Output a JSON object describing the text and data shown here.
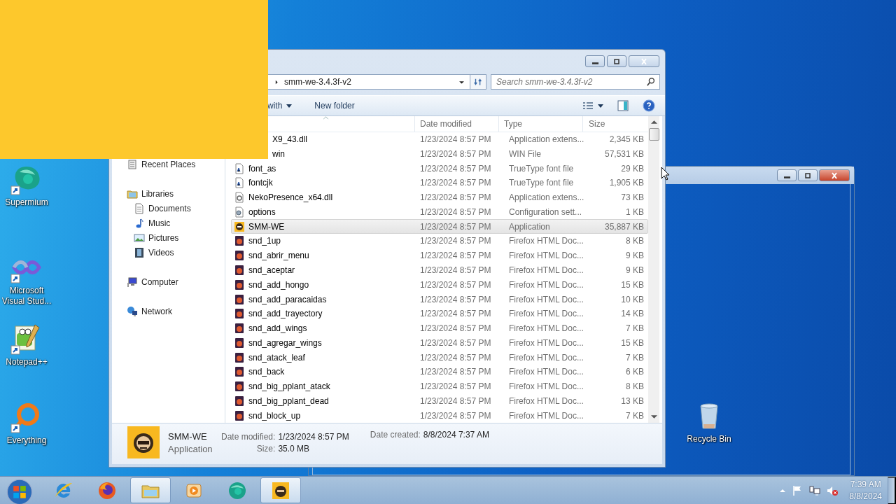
{
  "desktop_icons": [
    {
      "label": "Supermium",
      "kind": "supermium"
    },
    {
      "label": "Microsoft Visual Stud...",
      "kind": "vs"
    },
    {
      "label": "Notepad++",
      "kind": "notepad"
    },
    {
      "label": "Everything",
      "kind": "everything"
    },
    {
      "label": "Recycle Bin",
      "kind": "recycle"
    }
  ],
  "explorer": {
    "address": {
      "crumb": "smm-we-3.4.3f-v2"
    },
    "search": {
      "placeholder": "Search smm-we-3.4.3f-v2"
    },
    "toolbar": [
      {
        "label": "with",
        "kind": "menu"
      },
      {
        "label": "New folder",
        "kind": "plain"
      }
    ],
    "nav": [
      {
        "label": "Recent Places",
        "kind": "recent"
      },
      {
        "label": "Libraries",
        "kind": "libraries",
        "children": [
          {
            "label": "Documents",
            "kind": "documents"
          },
          {
            "label": "Music",
            "kind": "music"
          },
          {
            "label": "Pictures",
            "kind": "pictures"
          },
          {
            "label": "Videos",
            "kind": "videos"
          }
        ]
      },
      {
        "label": "Computer",
        "kind": "computer"
      },
      {
        "label": "Network",
        "kind": "network"
      }
    ],
    "columns": [
      "Date modified",
      "Type",
      "Size"
    ],
    "rows": [
      {
        "name": "X9_43.dll",
        "date": "1/23/2024 8:57 PM",
        "type": "Application extens...",
        "size": "2,345 KB",
        "selected": false
      },
      {
        "name": "win",
        "date": "1/23/2024 8:57 PM",
        "type": "WIN File",
        "size": "57,531 KB",
        "selected": false
      },
      {
        "name": "font_as",
        "date": "1/23/2024 8:57 PM",
        "type": "TrueType font file",
        "size": "29 KB",
        "kind": "font",
        "selected": false
      },
      {
        "name": "fontcjk",
        "date": "1/23/2024 8:57 PM",
        "type": "TrueType font file",
        "size": "1,905 KB",
        "kind": "font",
        "selected": false
      },
      {
        "name": "NekoPresence_x64.dll",
        "date": "1/23/2024 8:57 PM",
        "type": "Application extens...",
        "size": "73 KB",
        "kind": "dll",
        "selected": false
      },
      {
        "name": "options",
        "date": "1/23/2024 8:57 PM",
        "type": "Configuration sett...",
        "size": "1 KB",
        "kind": "settings",
        "selected": false
      },
      {
        "name": "SMM-WE",
        "date": "1/23/2024 8:57 PM",
        "type": "Application",
        "size": "35,887 KB",
        "kind": "app",
        "selected": true
      },
      {
        "name": "snd_1up",
        "date": "1/23/2024 8:57 PM",
        "type": "Firefox HTML Doc...",
        "size": "8 KB",
        "kind": "html",
        "selected": false
      },
      {
        "name": "snd_abrir_menu",
        "date": "1/23/2024 8:57 PM",
        "type": "Firefox HTML Doc...",
        "size": "9 KB",
        "kind": "html",
        "selected": false
      },
      {
        "name": "snd_aceptar",
        "date": "1/23/2024 8:57 PM",
        "type": "Firefox HTML Doc...",
        "size": "9 KB",
        "kind": "html",
        "selected": false
      },
      {
        "name": "snd_add_hongo",
        "date": "1/23/2024 8:57 PM",
        "type": "Firefox HTML Doc...",
        "size": "15 KB",
        "kind": "html",
        "selected": false
      },
      {
        "name": "snd_add_paracaidas",
        "date": "1/23/2024 8:57 PM",
        "type": "Firefox HTML Doc...",
        "size": "10 KB",
        "kind": "html",
        "selected": false
      },
      {
        "name": "snd_add_trayectory",
        "date": "1/23/2024 8:57 PM",
        "type": "Firefox HTML Doc...",
        "size": "14 KB",
        "kind": "html",
        "selected": false
      },
      {
        "name": "snd_add_wings",
        "date": "1/23/2024 8:57 PM",
        "type": "Firefox HTML Doc...",
        "size": "7 KB",
        "kind": "html",
        "selected": false
      },
      {
        "name": "snd_agregar_wings",
        "date": "1/23/2024 8:57 PM",
        "type": "Firefox HTML Doc...",
        "size": "15 KB",
        "kind": "html",
        "selected": false
      },
      {
        "name": "snd_atack_leaf",
        "date": "1/23/2024 8:57 PM",
        "type": "Firefox HTML Doc...",
        "size": "7 KB",
        "kind": "html",
        "selected": false
      },
      {
        "name": "snd_back",
        "date": "1/23/2024 8:57 PM",
        "type": "Firefox HTML Doc...",
        "size": "6 KB",
        "kind": "html",
        "selected": false
      },
      {
        "name": "snd_big_pplant_atack",
        "date": "1/23/2024 8:57 PM",
        "type": "Firefox HTML Doc...",
        "size": "8 KB",
        "kind": "html",
        "selected": false
      },
      {
        "name": "snd_big_pplant_dead",
        "date": "1/23/2024 8:57 PM",
        "type": "Firefox HTML Doc...",
        "size": "13 KB",
        "kind": "html",
        "selected": false
      },
      {
        "name": "snd_block_up",
        "date": "1/23/2024 8:57 PM",
        "type": "Firefox HTML Doc...",
        "size": "7 KB",
        "kind": "html",
        "selected": false
      }
    ],
    "details": {
      "name": "SMM-WE",
      "type": "Application",
      "fields": [
        {
          "label": "Date modified:",
          "value": "1/23/2024 8:57 PM"
        },
        {
          "label": "Size:",
          "value": "35.0 MB"
        },
        {
          "label": "Date created:",
          "value": "8/8/2024 7:37 AM"
        }
      ]
    }
  },
  "taskbar": {
    "apps": [
      {
        "kind": "ie",
        "active": false
      },
      {
        "kind": "firefox",
        "active": false
      },
      {
        "kind": "explorer",
        "active": true
      },
      {
        "kind": "media",
        "active": false
      },
      {
        "kind": "supermium",
        "active": false
      },
      {
        "kind": "smm",
        "active": true
      }
    ],
    "clock": {
      "time": "7:39 AM",
      "date": "8/8/2024"
    }
  }
}
